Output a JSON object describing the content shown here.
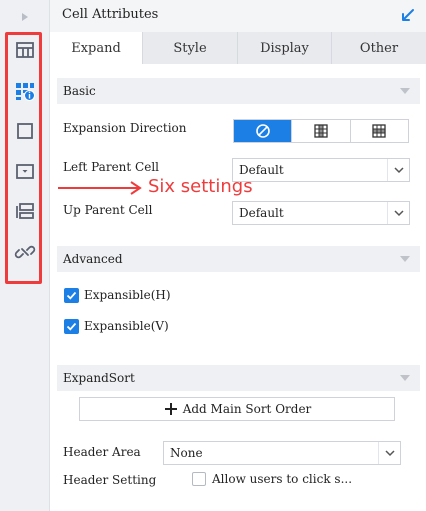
{
  "panel": {
    "title": "Cell Attributes"
  },
  "tabs": [
    {
      "label": "Expand",
      "active": true
    },
    {
      "label": "Style",
      "active": false
    },
    {
      "label": "Display",
      "active": false
    },
    {
      "label": "Other",
      "active": false
    }
  ],
  "sections": {
    "basic": "Basic",
    "advanced": "Advanced",
    "expand_sort": "ExpandSort"
  },
  "basic": {
    "expansion_direction_label": "Expansion Direction",
    "direction_options": [
      "none-icon",
      "vertical-expand-icon",
      "horizontal-expand-icon"
    ],
    "direction_selected": "none-icon",
    "left_parent_label": "Left Parent Cell",
    "left_parent_value": "Default",
    "up_parent_label": "Up Parent Cell",
    "up_parent_value": "Default"
  },
  "annotation": {
    "text": "Six settings"
  },
  "advanced": {
    "expansible_h": "Expansible(H)",
    "expansible_h_checked": true,
    "expansible_v": "Expansible(V)",
    "expansible_v_checked": true
  },
  "expand_sort": {
    "add_main_sort_order": "Add Main Sort Order",
    "header_area_label": "Header Area",
    "header_area_value": "None",
    "header_setting_label": "Header Setting",
    "header_setting_option": "Allow users to click s...",
    "header_setting_checked": false
  },
  "rail_icons": [
    "cell-attributes-icon",
    "cell-element-icon",
    "border-icon",
    "widget-icon",
    "layout-icon",
    "hyperlink-icon"
  ],
  "colors": {
    "accent": "#1b7fe6",
    "highlight": "#ef3b3b",
    "rail_bg": "#eef0f3",
    "tab_bg": "#e8eaee"
  }
}
